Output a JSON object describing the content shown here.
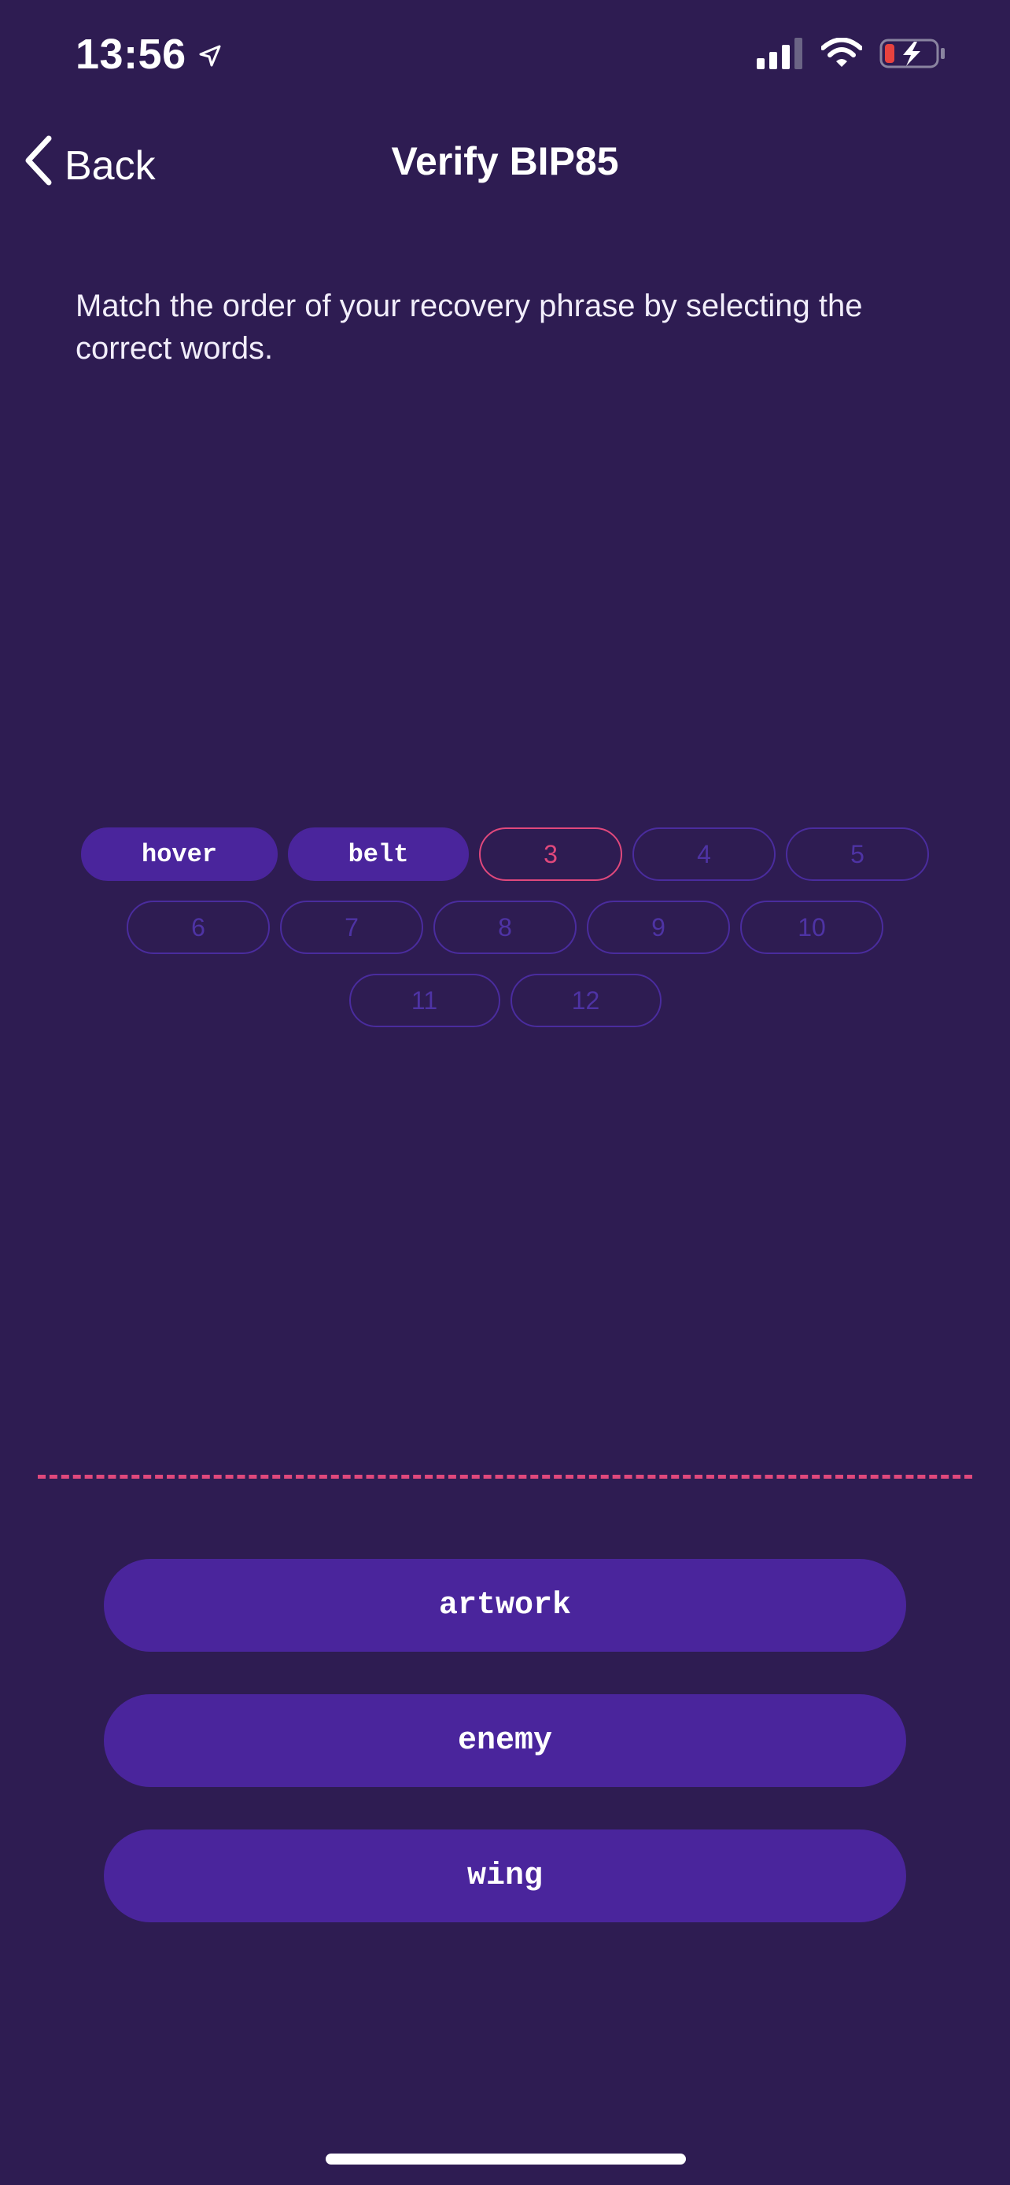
{
  "status_bar": {
    "time": "13:56",
    "icons": [
      "location-arrow-icon",
      "cellular-signal-icon",
      "wifi-icon",
      "battery-charging-icon"
    ]
  },
  "nav": {
    "back_label": "Back",
    "title": "Verify BIP85"
  },
  "instruction": "Match the order of your recovery phrase by selecting the correct words.",
  "slots": {
    "row1": [
      {
        "label": "hover",
        "state": "filled"
      },
      {
        "label": "belt",
        "state": "filled"
      },
      {
        "label": "3",
        "state": "active"
      },
      {
        "label": "4",
        "state": "empty"
      },
      {
        "label": "5",
        "state": "empty"
      }
    ],
    "row2": [
      {
        "label": "6",
        "state": "empty"
      },
      {
        "label": "7",
        "state": "empty"
      },
      {
        "label": "8",
        "state": "empty"
      },
      {
        "label": "9",
        "state": "empty"
      },
      {
        "label": "10",
        "state": "empty"
      }
    ],
    "row3": [
      {
        "label": "11",
        "state": "empty"
      },
      {
        "label": "12",
        "state": "empty"
      }
    ]
  },
  "choices": [
    "artwork",
    "enemy",
    "wing"
  ],
  "colors": {
    "background": "#2e1c52",
    "accent": "#4a259c",
    "highlight": "#e0487c",
    "battery_low": "#e8423f"
  }
}
